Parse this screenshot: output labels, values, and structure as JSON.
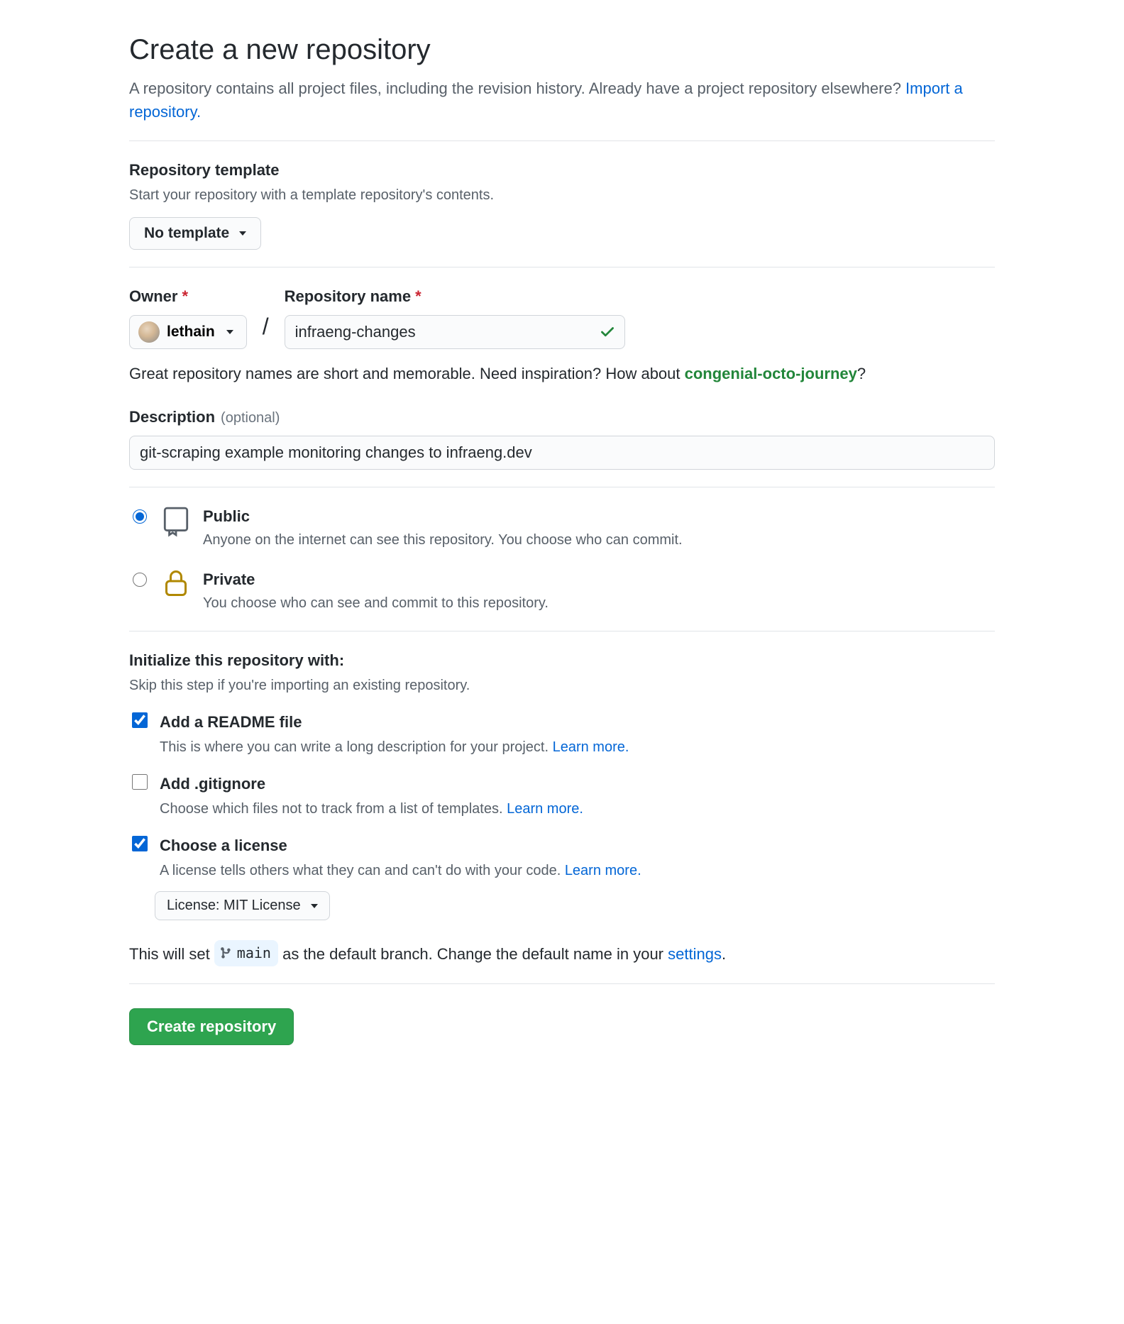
{
  "header": {
    "title": "Create a new repository",
    "subtitle_prefix": "A repository contains all project files, including the revision history. Already have a project repository elsewhere? ",
    "import_link": "Import a repository."
  },
  "template": {
    "title": "Repository template",
    "subtitle": "Start your repository with a template repository's contents.",
    "button_label": "No template"
  },
  "owner": {
    "label": "Owner",
    "value": "lethain"
  },
  "repo_name": {
    "label": "Repository name",
    "value": "infraeng-changes"
  },
  "name_hint": {
    "prefix": "Great repository names are short and memorable. Need inspiration? How about ",
    "suggestion": "congenial-octo-journey",
    "suffix": "?"
  },
  "description": {
    "label": "Description",
    "optional": "(optional)",
    "value": "git-scraping example monitoring changes to infraeng.dev"
  },
  "visibility": {
    "public": {
      "title": "Public",
      "sub": "Anyone on the internet can see this repository. You choose who can commit."
    },
    "private": {
      "title": "Private",
      "sub": "You choose who can see and commit to this repository."
    }
  },
  "init": {
    "title": "Initialize this repository with:",
    "subtitle": "Skip this step if you're importing an existing repository.",
    "readme": {
      "title": "Add a README file",
      "sub_prefix": "This is where you can write a long description for your project. ",
      "learn_more": "Learn more."
    },
    "gitignore": {
      "title": "Add .gitignore",
      "sub_prefix": "Choose which files not to track from a list of templates. ",
      "learn_more": "Learn more."
    },
    "license": {
      "title": "Choose a license",
      "sub_prefix": "A license tells others what they can and can't do with your code. ",
      "learn_more": "Learn more.",
      "select_label": "License: MIT License"
    }
  },
  "branch_note": {
    "prefix": "This will set ",
    "branch": "main",
    "mid": " as the default branch. Change the default name in your ",
    "settings": "settings",
    "suffix": "."
  },
  "create_button": "Create repository"
}
